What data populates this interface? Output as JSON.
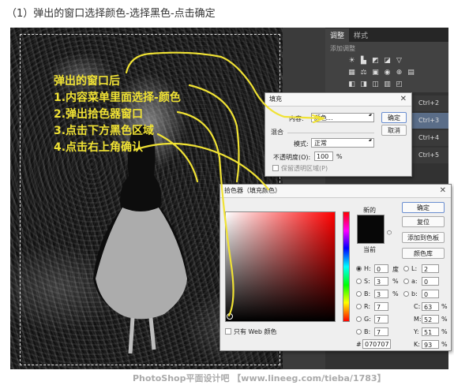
{
  "caption": "（1）弹出的窗口选择颜色-选择黑色-点击确定",
  "overlay": {
    "lines": [
      "弹出的窗口后",
      "1.内容菜单里面选择-颜色",
      "2.弹出拾色器窗口",
      "3.点击下方黑色区域",
      "4.点击右上角确认"
    ]
  },
  "panel": {
    "tabs": [
      "调整",
      "样式"
    ],
    "adjust_title": "添加调整",
    "layers": [
      "Ctrl+2",
      "Ctrl+3",
      "Ctrl+4",
      "Ctrl+5"
    ]
  },
  "fill_dialog": {
    "title": "填充",
    "content_label": "内容:",
    "content_value": "颜色...",
    "ok": "确定",
    "cancel": "取消",
    "blend_label": "混合",
    "mode_label": "模式:",
    "mode_value": "正常",
    "opacity_label": "不透明度(O):",
    "opacity_value": "100",
    "opacity_unit": "%",
    "preserve_label": "保留透明区域(P)"
  },
  "picker": {
    "title": "拾色器（填充颜色）",
    "ok": "确定",
    "reset": "复位",
    "add_swatch": "添加到色板",
    "libraries": "颜色库",
    "new_label": "新的",
    "current_label": "当前",
    "web_only": "只有 Web 颜色",
    "hsb": [
      {
        "k": "H:",
        "v": "0",
        "u": "度"
      },
      {
        "k": "S:",
        "v": "3",
        "u": "%"
      },
      {
        "k": "B:",
        "v": "3",
        "u": "%"
      }
    ],
    "rgb": [
      {
        "k": "R:",
        "v": "7"
      },
      {
        "k": "G:",
        "v": "7"
      },
      {
        "k": "B:",
        "v": "7"
      }
    ],
    "lab": [
      {
        "k": "L:",
        "v": "2"
      },
      {
        "k": "a:",
        "v": "0"
      },
      {
        "k": "b:",
        "v": "0"
      }
    ],
    "cmyk": [
      {
        "k": "C:",
        "v": "63",
        "u": "%"
      },
      {
        "k": "M:",
        "v": "52",
        "u": "%"
      },
      {
        "k": "Y:",
        "v": "51",
        "u": "%"
      },
      {
        "k": "K:",
        "v": "93",
        "u": "%"
      }
    ],
    "hex_label": "#",
    "hex_value": "070707"
  },
  "watermark": "PhotoShop平面设计吧 【www.lineeg.com/tieba/1783】",
  "colors": {
    "annotation": "#f0e234",
    "selected_layer": "#5a6d88"
  }
}
